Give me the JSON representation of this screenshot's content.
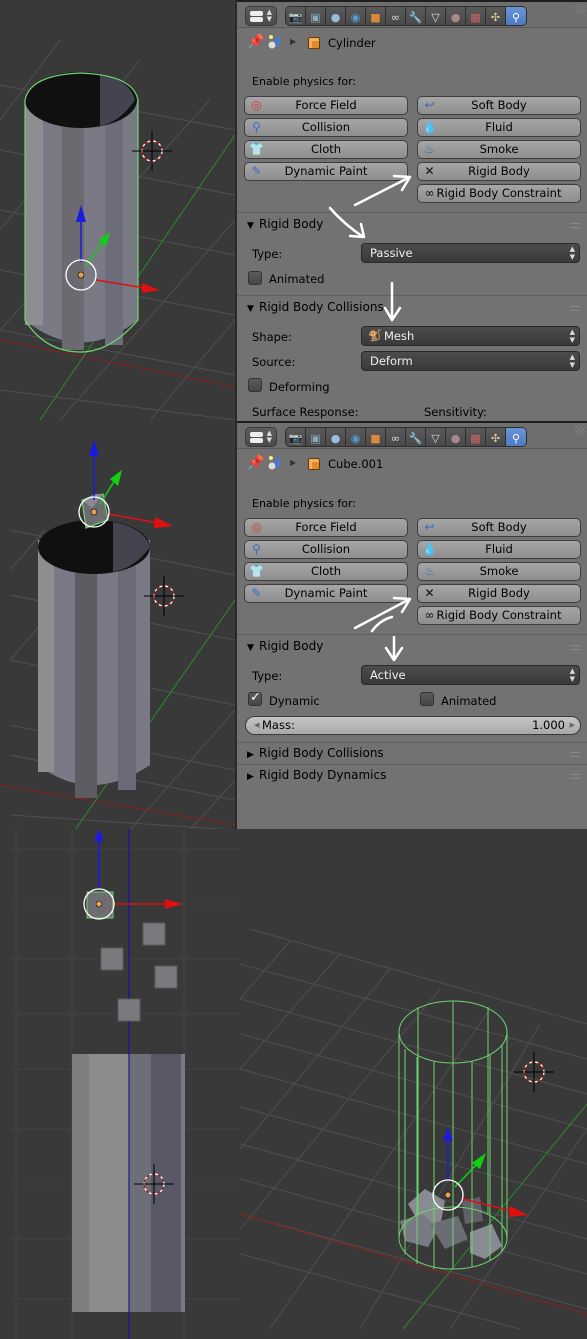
{
  "panels": [
    {
      "object_name": "Cylinder",
      "enable_physics_label": "Enable physics for:",
      "physics_buttons": [
        {
          "label": "Force Field",
          "icon": "force-field-icon"
        },
        {
          "label": "Soft Body",
          "icon": "soft-body-icon"
        },
        {
          "label": "Collision",
          "icon": "collision-icon"
        },
        {
          "label": "Fluid",
          "icon": "fluid-icon"
        },
        {
          "label": "Cloth",
          "icon": "cloth-icon"
        },
        {
          "label": "Smoke",
          "icon": "smoke-icon"
        },
        {
          "label": "Dynamic Paint",
          "icon": "dynamic-paint-icon"
        },
        {
          "label": "Rigid Body",
          "icon": "close-x-icon"
        },
        {
          "label": "Rigid Body Constraint",
          "icon": "chain-link-icon"
        }
      ],
      "rigid_body": {
        "title": "Rigid Body",
        "type_label": "Type:",
        "type_value": "Passive",
        "animated_label": "Animated",
        "animated_checked": false
      },
      "collisions": {
        "title": "Rigid Body Collisions",
        "shape_label": "Shape:",
        "shape_value": "Mesh",
        "source_label": "Source:",
        "source_value": "Deform",
        "deforming_label": "Deforming",
        "deforming_checked": false,
        "surface_response_label": "Surface Response:",
        "sensitivity_label": "Sensitivity:"
      }
    },
    {
      "object_name": "Cube.001",
      "enable_physics_label": "Enable physics for:",
      "physics_buttons": [
        {
          "label": "Force Field",
          "icon": "force-field-icon"
        },
        {
          "label": "Soft Body",
          "icon": "soft-body-icon"
        },
        {
          "label": "Collision",
          "icon": "collision-icon"
        },
        {
          "label": "Fluid",
          "icon": "fluid-icon"
        },
        {
          "label": "Cloth",
          "icon": "cloth-icon"
        },
        {
          "label": "Smoke",
          "icon": "smoke-icon"
        },
        {
          "label": "Dynamic Paint",
          "icon": "dynamic-paint-icon"
        },
        {
          "label": "Rigid Body",
          "icon": "close-x-icon"
        },
        {
          "label": "Rigid Body Constraint",
          "icon": "chain-link-icon"
        }
      ],
      "rigid_body": {
        "title": "Rigid Body",
        "type_label": "Type:",
        "type_value": "Active",
        "dynamic_label": "Dynamic",
        "dynamic_checked": true,
        "animated_label": "Animated",
        "animated_checked": false,
        "mass_label": "Mass:",
        "mass_value": "1.000"
      },
      "collapsed_sections": [
        "Rigid Body Collisions",
        "Rigid Body Dynamics"
      ]
    }
  ],
  "header_tabs": [
    "render",
    "render-layers",
    "scene",
    "world",
    "object",
    "constraints",
    "modifiers",
    "data",
    "material",
    "texture",
    "particles",
    "physics"
  ],
  "active_tab": "physics",
  "colors": {
    "viewport_bg": "#393939",
    "panel_bg": "#727272",
    "selection_green": "#6fd36f",
    "axis_x": "#e01010",
    "axis_y": "#10d010",
    "axis_z": "#1a1ae0",
    "active_tab": "#5a86c8"
  }
}
